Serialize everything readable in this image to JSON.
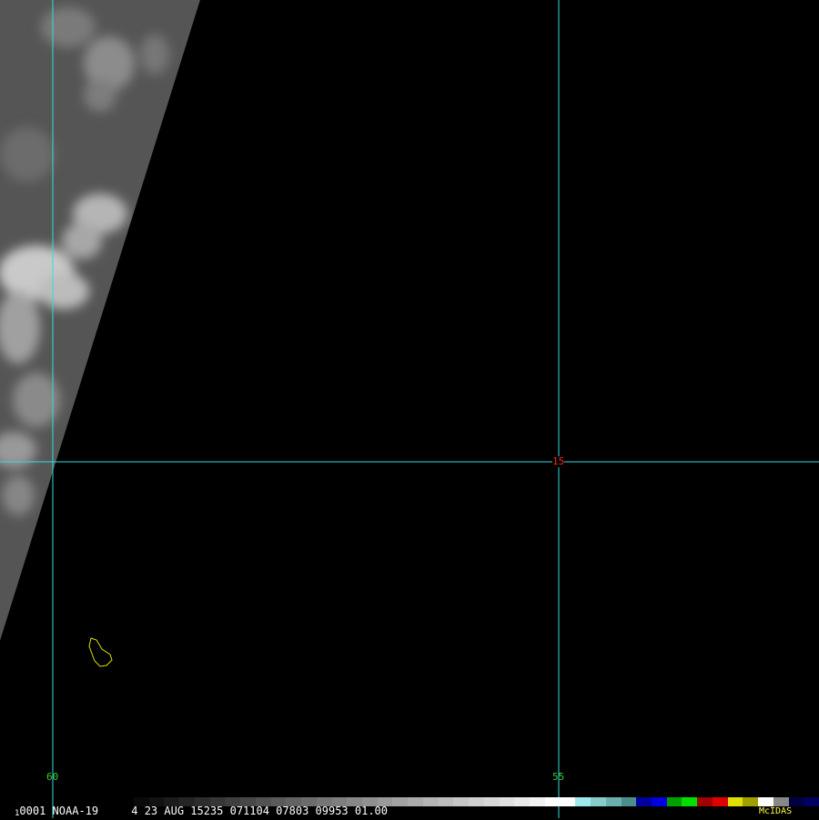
{
  "map": {
    "longitude_labels": [
      {
        "value": "60",
        "lon": -60
      },
      {
        "value": "55",
        "lon": -55
      }
    ],
    "latitude_labels": [
      {
        "value": "15",
        "lat": 15
      }
    ],
    "label_colors": {
      "longitude": "#33cc33",
      "latitude": "#ff2222"
    },
    "grid_color": "#33dddd",
    "coastline_color": "#e0e000",
    "imagery": "infrared-cloud-swath",
    "island_feature": "barbados-outline-icon"
  },
  "status_bar": {
    "frame_prefix": "1",
    "text": "0001 NOAA-19     4 23 AUG 15235 071104 07803 09953 01.00",
    "logo": "McIDAS",
    "logo_color": "#ffff44",
    "colorbar_colors": [
      "#0a0a0a",
      "#121212",
      "#1b1b1b",
      "#242424",
      "#2d2d2d",
      "#363636",
      "#3f3f3f",
      "#484848",
      "#515151",
      "#5a5a5a",
      "#636363",
      "#6c6c6c",
      "#757575",
      "#7e7e7e",
      "#878787",
      "#909090",
      "#999999",
      "#a2a2a2",
      "#ababab",
      "#b4b4b4",
      "#bdbdbd",
      "#c6c6c6",
      "#cfcfcf",
      "#d8d8d8",
      "#e1e1e1",
      "#eaeaea",
      "#f3f3f3",
      "#ffffff",
      "#ffffff",
      "#9ee8ee",
      "#86cccc",
      "#6ab0b0",
      "#4c8d8d",
      "#0000a0",
      "#0000e0",
      "#00a000",
      "#00e000",
      "#a00000",
      "#e00000",
      "#e0e000",
      "#a0a000",
      "#ffffff",
      "#888888",
      "#000040",
      "#000060"
    ]
  }
}
